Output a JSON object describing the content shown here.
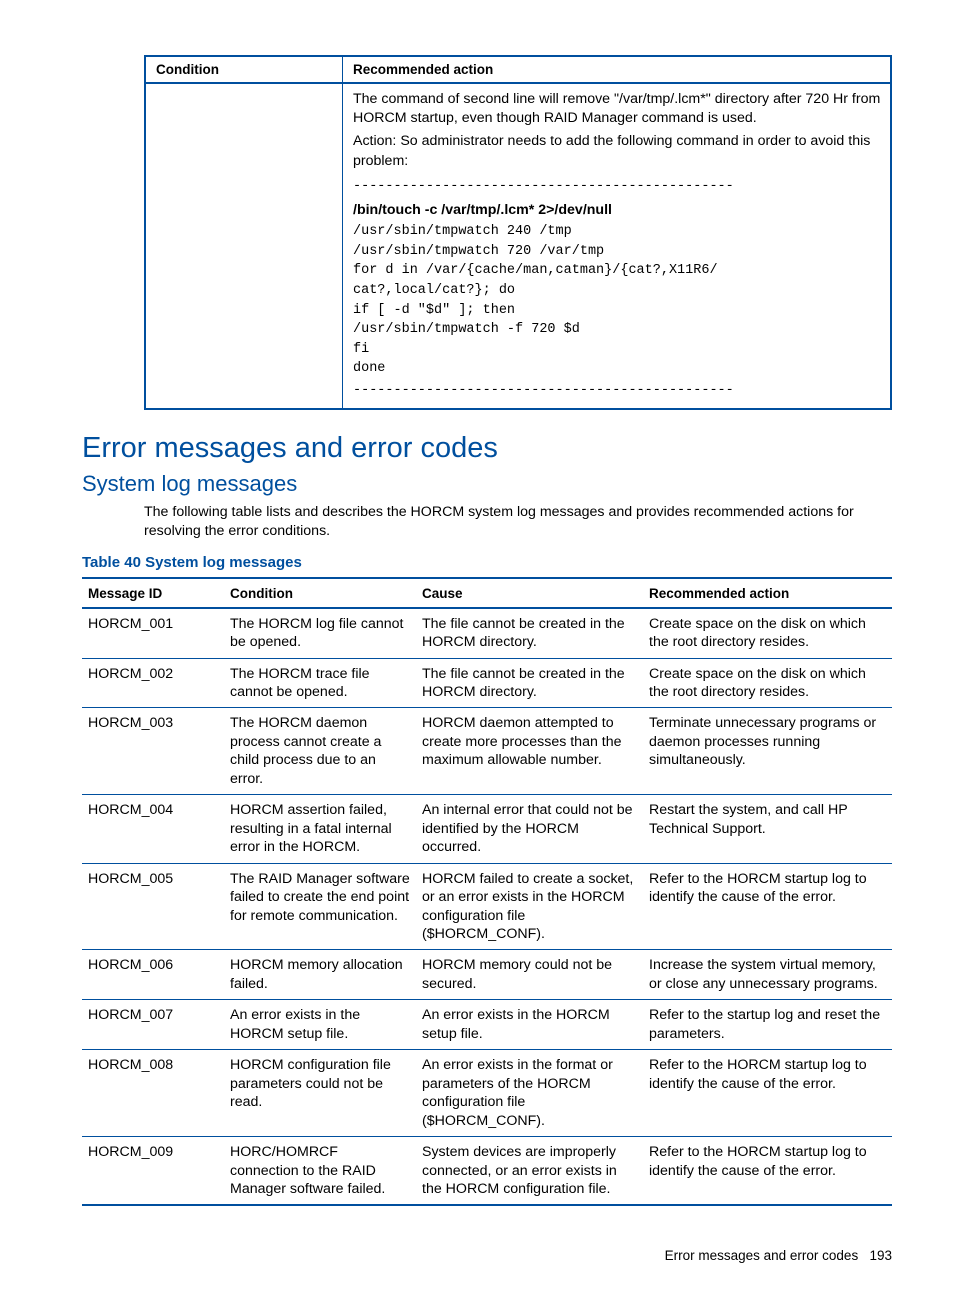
{
  "table1": {
    "headers": {
      "condition": "Condition",
      "action": "Recommended action"
    },
    "row": {
      "para1": "The command of second line will remove \"/var/tmp/.lcm*\" directory after 720 Hr from HORCM startup, even though RAID Manager command is used.",
      "para2": "Action: So administrator needs to add the following command in order to avoid this problem:",
      "sep": "-----------------------------------------------",
      "cmd": "/bin/touch -c /var/tmp/.lcm* 2>/dev/null",
      "code": [
        "/usr/sbin/tmpwatch 240 /tmp",
        "/usr/sbin/tmpwatch 720 /var/tmp",
        "for d in /var/{cache/man,catman}/{cat?,X11R6/",
        "cat?,local/cat?}; do",
        "    if [ -d \"$d\" ]; then",
        "            /usr/sbin/tmpwatch -f 720 $d",
        "    fi",
        "done"
      ]
    }
  },
  "h1": "Error messages and error codes",
  "h2": "System log messages",
  "intro": "The following table lists and describes the HORCM system log messages and provides recommended actions for resolving the error conditions.",
  "tablecap": "Table 40 System log messages",
  "table2": {
    "headers": {
      "id": "Message ID",
      "cond": "Condition",
      "cause": "Cause",
      "action": "Recommended action"
    },
    "rows": [
      {
        "id": "HORCM_001",
        "cond": "The HORCM log file cannot be opened.",
        "cause": "The file cannot be created in the HORCM directory.",
        "action": "Create space on the disk on which the root directory resides."
      },
      {
        "id": "HORCM_002",
        "cond": "The HORCM trace file cannot be opened.",
        "cause": "The file cannot be created in the HORCM directory.",
        "action": "Create space on the disk on which the root directory resides."
      },
      {
        "id": "HORCM_003",
        "cond": "The HORCM daemon process cannot create a child process due to an error.",
        "cause": "HORCM daemon attempted to create more processes than the maximum allowable number.",
        "action": "Terminate unnecessary programs or daemon processes running simultaneously."
      },
      {
        "id": "HORCM_004",
        "cond": "HORCM assertion failed, resulting in a fatal internal error in the HORCM.",
        "cause": "An internal error that could not be identified by the HORCM occurred.",
        "action": "Restart the system, and call HP Technical Support."
      },
      {
        "id": "HORCM_005",
        "cond": "The RAID Manager software failed to create the end point for remote communication.",
        "cause": "HORCM failed to create a socket, or an error exists in the HORCM configuration file ($HORCM_CONF).",
        "action": "Refer to the HORCM startup log to identify the cause of the error."
      },
      {
        "id": "HORCM_006",
        "cond": "HORCM memory allocation failed.",
        "cause": "HORCM memory could not be secured.",
        "action": "Increase the system virtual memory, or close any unnecessary programs."
      },
      {
        "id": "HORCM_007",
        "cond": "An error exists in the HORCM setup file.",
        "cause": "An error exists in the HORCM setup file.",
        "action": "Refer to the startup log and reset the parameters."
      },
      {
        "id": "HORCM_008",
        "cond": "HORCM configuration file parameters could not be read.",
        "cause": "An error exists in the format or parameters of the HORCM configuration file ($HORCM_CONF).",
        "action": "Refer to the HORCM startup log to identify the cause of the error."
      },
      {
        "id": "HORCM_009",
        "cond": "HORC/HOMRCF connection to the RAID Manager software failed.",
        "cause": "System devices are improperly connected, or an error exists in the HORCM configuration file.",
        "action": "Refer to the HORCM startup log to identify the cause of the error."
      }
    ]
  },
  "footer": {
    "text": "Error messages and error codes",
    "page": "193"
  }
}
